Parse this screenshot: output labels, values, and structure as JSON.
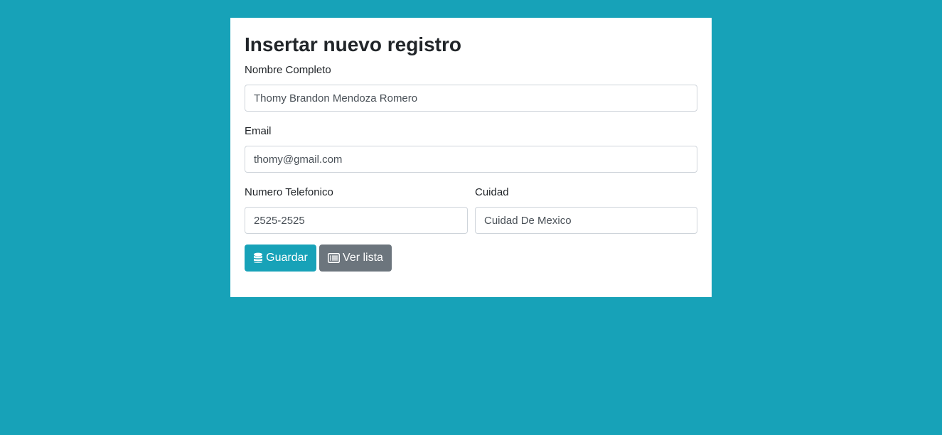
{
  "form": {
    "title": "Insertar nuevo registro",
    "fields": {
      "nombre": {
        "label": "Nombre Completo",
        "value": "Thomy Brandon Mendoza Romero"
      },
      "email": {
        "label": "Email",
        "value": "thomy@gmail.com"
      },
      "telefono": {
        "label": "Numero Telefonico",
        "value": "2525-2525"
      },
      "ciudad": {
        "label": "Cuidad",
        "value": "Cuidad De Mexico"
      }
    },
    "buttons": {
      "save_label": "Guardar",
      "save_icon": "database-icon",
      "list_label": "Ver lista",
      "list_icon": "list-icon"
    }
  },
  "colors": {
    "background": "#17a2b8",
    "primary": "#17a2b8",
    "secondary": "#6c757d"
  }
}
